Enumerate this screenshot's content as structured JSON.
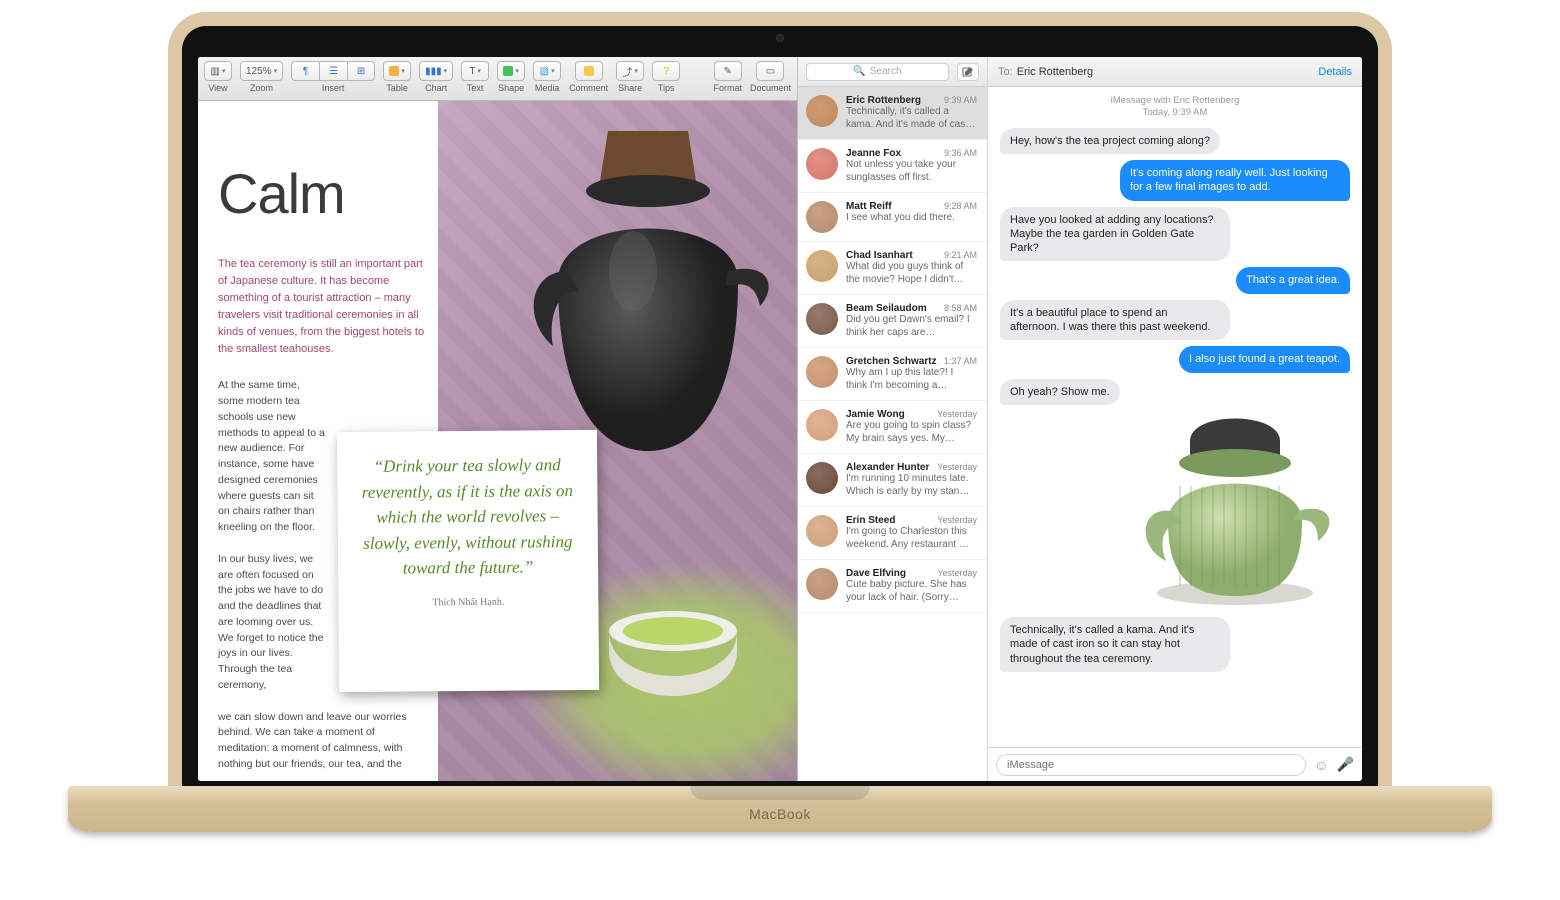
{
  "device_label": "MacBook",
  "pages": {
    "toolbar": {
      "view": "View",
      "zoom_val": "125%",
      "zoom": "Zoom",
      "insert": "Insert",
      "table": "Table",
      "chart": "Chart",
      "text": "Text",
      "shape": "Shape",
      "media": "Media",
      "comment": "Comment",
      "share": "Share",
      "tips": "Tips",
      "format": "Format",
      "document": "Document"
    },
    "doc": {
      "title": "Calm",
      "intro": "The tea ceremony is still an important part of Japanese culture. It has become something of a tourist attraction – many travelers visit traditional ceremonies in all kinds of venues, from the biggest hotels to the smallest teahouses.",
      "p1": "At the same time, some modern tea schools use new methods to appeal to a new audience. For instance, some have designed ceremonies where guests can sit on chairs rather than kneeling on the floor.",
      "p2": "In our busy lives, we are often focused on the jobs we have to do and the deadlines that are looming over us. We forget to notice the joys in our lives. Through the tea ceremony,",
      "p2b": "we can slow down and leave our worries behind. We can take a moment of meditation: a moment of calmness, with nothing but our friends, our tea, and the",
      "quote": "“Drink your tea slowly and reverently, as if it is the axis on which the world revolves – slowly, evenly, without rushing toward the future.”",
      "quote_attr": "Thích Nhất Hạnh."
    }
  },
  "messages": {
    "search_placeholder": "Search",
    "header": {
      "to_label": "To:",
      "to_name": "Eric Rottenberg",
      "details": "Details"
    },
    "meta_line1": "iMessage with  Eric Rottenberg",
    "meta_line2": "Today, 9:39 AM",
    "conversations": [
      {
        "name": "Eric Rottenberg",
        "time": "9:39 AM",
        "preview": "Technically, it's called a kama. And it's made of cast iron so…",
        "hue": "#c58a5a"
      },
      {
        "name": "Jeanne Fox",
        "time": "9:36 AM",
        "preview": "Not unless you take your sunglasses off first.",
        "hue": "#d9766a"
      },
      {
        "name": "Matt Reiff",
        "time": "9:28 AM",
        "preview": "I see what you did there.",
        "hue": "#b98a6a"
      },
      {
        "name": "Chad Isanhart",
        "time": "9:21 AM",
        "preview": "What did you guys think of the movie? Hope I didn't over…",
        "hue": "#caa06a"
      },
      {
        "name": "Beam Seilaudom",
        "time": "8:58 AM",
        "preview": "Did you get Dawn's email? I think her caps are permanen…",
        "hue": "#7a5a4a"
      },
      {
        "name": "Gretchen Schwartz",
        "time": "1:37 AM",
        "preview": "Why am I up this late?! I think I'm becoming a vampire. Bu…",
        "hue": "#c9906a"
      },
      {
        "name": "Jamie Wong",
        "time": "Yesterday",
        "preview": "Are you going to spin class? My brain says yes. My thighs…",
        "hue": "#d7a07a"
      },
      {
        "name": "Alexander Hunter",
        "time": "Yesterday",
        "preview": "I'm running 10 minutes late. Which is early by my stan…",
        "hue": "#6a4a3a"
      },
      {
        "name": "Erin Steed",
        "time": "Yesterday",
        "preview": "I'm going to Charleston this weekend. Any restaurant …",
        "hue": "#cfa07a"
      },
      {
        "name": "Dave Elfving",
        "time": "Yesterday",
        "preview": "Cute baby picture. She has your lack of hair. (Sorry…",
        "hue": "#ba8a6a"
      }
    ],
    "thread": [
      {
        "dir": "in",
        "text": "Hey, how's the tea project coming along?"
      },
      {
        "dir": "out",
        "text": "It's coming along really well. Just looking for a few final images to add."
      },
      {
        "dir": "in",
        "text": "Have you looked at adding any locations? Maybe the tea garden in Golden Gate Park?"
      },
      {
        "dir": "out",
        "text": "That's a great idea."
      },
      {
        "dir": "in",
        "text": "It's a beautiful place to spend an afternoon. I was there this past weekend."
      },
      {
        "dir": "out",
        "text": "I also just found a great teapot."
      },
      {
        "dir": "in",
        "text": "Oh yeah? Show me."
      },
      {
        "dir": "img"
      },
      {
        "dir": "in",
        "text": "Technically, it's called a kama. And it's made of cast iron so it can stay hot throughout the tea ceremony."
      }
    ],
    "compose_placeholder": "iMessage"
  }
}
